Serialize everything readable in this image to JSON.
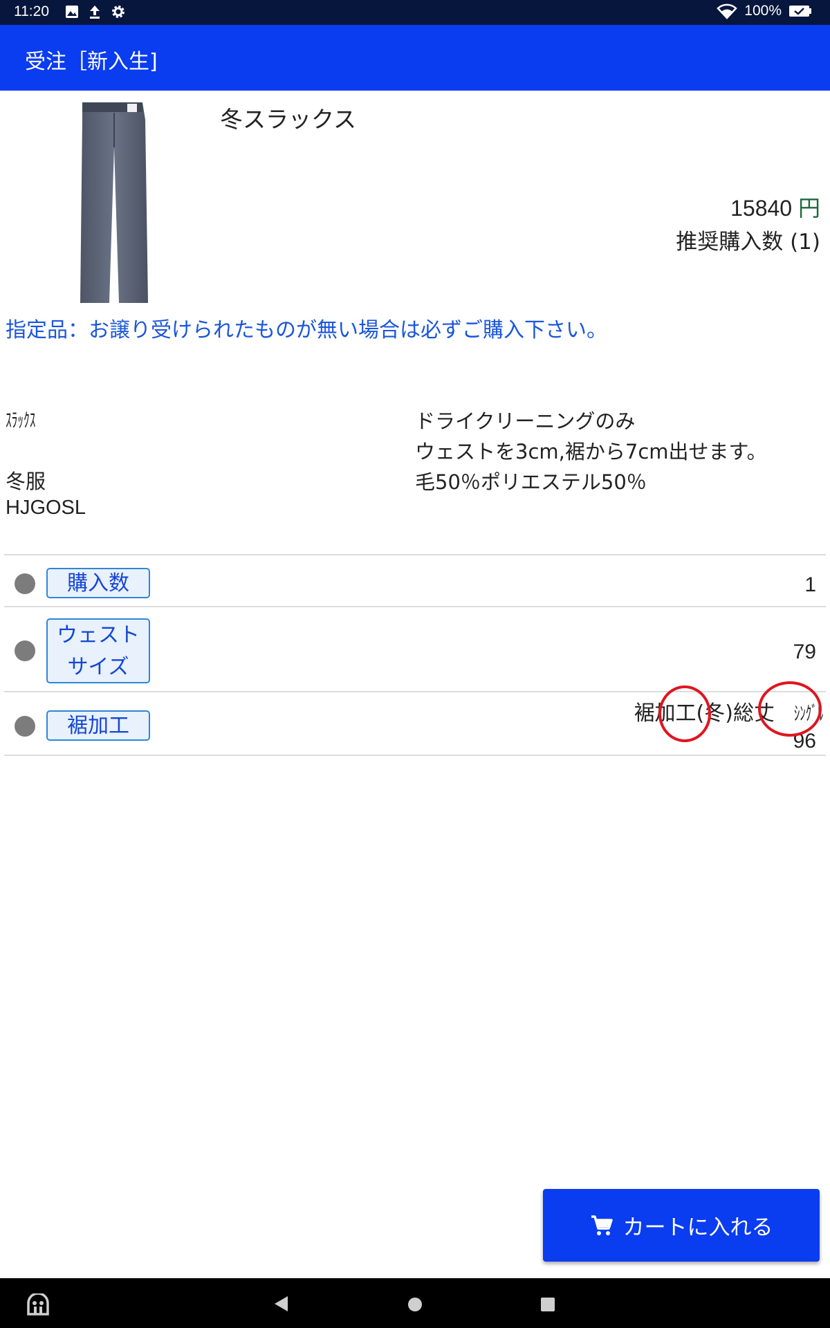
{
  "status_bar": {
    "time": "11:20",
    "battery": "100%"
  },
  "app_bar": {
    "title": "受注［新入生]"
  },
  "product": {
    "name": "冬スラックス",
    "price": "15840",
    "currency": "円",
    "recommended_qty": "推奨購入数 (1)",
    "notice": "指定品：お譲り受けられたものが無い場合は必ずご購入下さい。"
  },
  "info": {
    "category": "ｽﾗｯｸｽ",
    "season": "冬服",
    "code": "HJGOSL",
    "care": "ドライクリーニングのみ",
    "alteration": "ウェストを3cm,裾から7cm出せます。",
    "material": "毛50％ポリエステル50％"
  },
  "options": [
    {
      "label": "購入数",
      "value": "1"
    },
    {
      "label_line1": "ウェスト",
      "label_line2": "サイズ",
      "value": "79"
    },
    {
      "label": "裾加工",
      "detail_main": "裾加工(冬)総丈",
      "detail_narrow": "ｼﾝｸﾞﾙ",
      "value": "96"
    }
  ],
  "cart_button": {
    "label": "カートに入れる"
  },
  "colors": {
    "primary": "#0a3cf0",
    "notice": "#1a56db",
    "annotation": "#e0151f"
  }
}
